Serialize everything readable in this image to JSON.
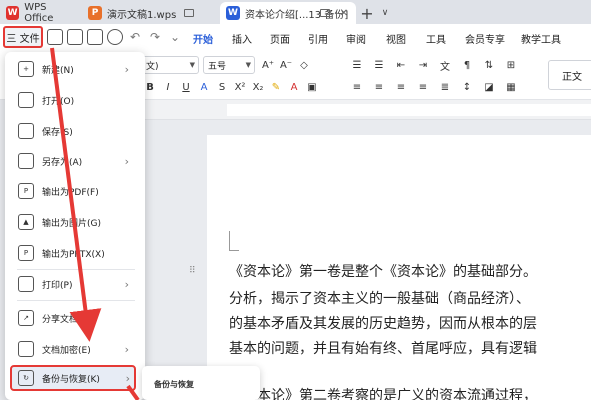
{
  "titlebar": {
    "tabs": [
      {
        "label": "WPS Office",
        "icon": "W"
      },
      {
        "label": "演示文稿1.wps",
        "icon": "P"
      },
      {
        "label": "资本论介绍[...13 备份]",
        "icon": "W"
      }
    ],
    "new_tab": "+",
    "more": "∨"
  },
  "ribbon": {
    "file_label": "三 文件",
    "tabs": [
      "开始",
      "插入",
      "页面",
      "引用",
      "审阅",
      "视图",
      "工具",
      "会员专享",
      "教学工具"
    ],
    "active_tab": "开始"
  },
  "toolbar": {
    "font_name": "文)",
    "font_size": "五号",
    "style_preview": "正文"
  },
  "file_menu": {
    "items": [
      {
        "label": "新建(N)",
        "icon": "new-doc-icon",
        "submenu": true
      },
      {
        "label": "打开(O)",
        "icon": "folder-icon",
        "submenu": false
      },
      {
        "label": "保存(S)",
        "icon": "save-icon",
        "submenu": false
      },
      {
        "label": "另存为(A)",
        "icon": "save-as-icon",
        "submenu": true
      },
      {
        "label": "输出为PDF(F)",
        "icon": "pdf-icon",
        "submenu": false
      },
      {
        "label": "输出为图片(G)",
        "icon": "image-icon",
        "submenu": false
      },
      {
        "label": "输出为PPTX(X)",
        "icon": "pptx-icon",
        "submenu": false
      },
      {
        "label": "打印(P)",
        "icon": "print-icon",
        "submenu": true
      },
      {
        "label": "分享文档(D)",
        "icon": "share-icon",
        "submenu": false
      },
      {
        "label": "文档加密(E)",
        "icon": "lock-icon",
        "submenu": true
      },
      {
        "label": "备份与恢复(K)",
        "icon": "backup-icon",
        "submenu": true
      }
    ],
    "highlighted": "备份与恢复(K)"
  },
  "submenu": {
    "title": "备份与恢复"
  },
  "document": {
    "lines": [
      "《资本论》第一卷是整个《资本论》的基础部分。",
      "分析，揭示了资本主义的一般基础（商品经济）、",
      "的基本矛盾及其发展的历史趋势，因而从根本的层",
      "基本的问题，并且有始有终、首尾呼应，具有逻辑",
      "《资本论》第二卷考察的是广义的资本流通过程，"
    ]
  },
  "colors": {
    "accent": "#2b5fd9",
    "annotation": "#e53935"
  }
}
